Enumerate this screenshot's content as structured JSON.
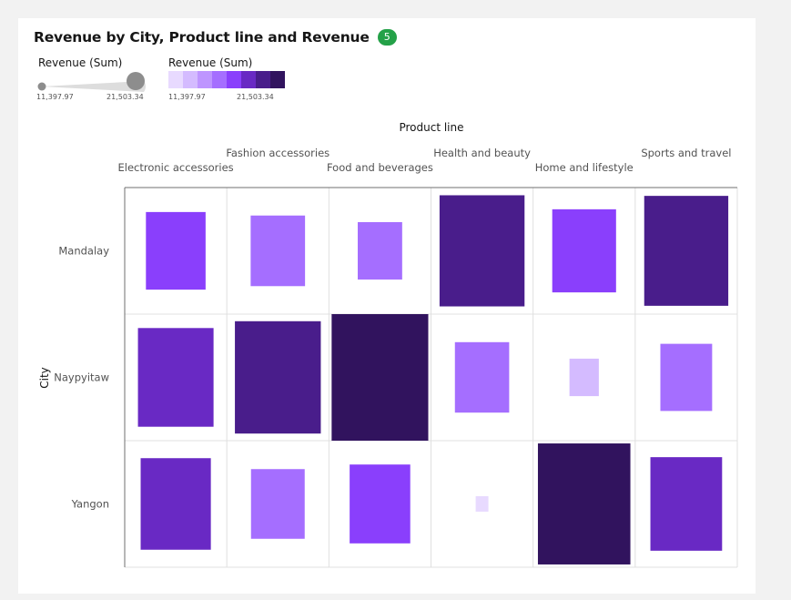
{
  "card": {
    "title": "Revenue by City, Product line and Revenue",
    "badge": "5"
  },
  "legend": {
    "size_title": "Revenue (Sum)",
    "size_min": "11,397.97",
    "size_max": "21,503.34",
    "color_title": "Revenue (Sum)",
    "color_min": "11,397.97",
    "color_max": "21,503.34",
    "color_steps": [
      "#e8daff",
      "#d4bbff",
      "#be95ff",
      "#a56eff",
      "#8a3ffc",
      "#6929c4",
      "#491d8b",
      "#31135e"
    ]
  },
  "chart_data": {
    "type": "heatmap",
    "x_title": "Product line",
    "y_title": "City",
    "x_categories": [
      "Electronic accessories",
      "Fashion accessories",
      "Food and beverages",
      "Health and beauty",
      "Home and lifestyle",
      "Sports and travel"
    ],
    "y_categories": [
      "Mandalay",
      "Naypyitaw",
      "Yangon"
    ],
    "value_range": [
      11397.97,
      21503.34
    ],
    "values": [
      [
        17051,
        16413,
        15215,
        20100,
        17550,
        19989
      ],
      [
        18969,
        20210,
        21503,
        16400,
        13400,
        16100
      ],
      [
        18318,
        16330,
        17163,
        11398,
        21000,
        18500
      ]
    ]
  }
}
